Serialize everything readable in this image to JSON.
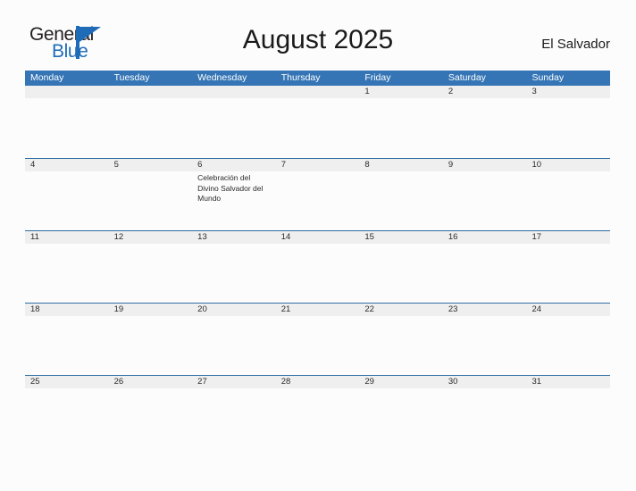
{
  "brand": {
    "word_one": "General",
    "word_two": "Blue",
    "accent_color": "#1e6bb8"
  },
  "header": {
    "title": "August 2025",
    "country": "El Salvador"
  },
  "colors": {
    "header_blue": "#3575b5",
    "rule_blue": "#2e6da4",
    "number_band": "#efeff0",
    "page_background": "#fcfcfd"
  },
  "calendar": {
    "day_headers": [
      "Monday",
      "Tuesday",
      "Wednesday",
      "Thursday",
      "Friday",
      "Saturday",
      "Sunday"
    ],
    "weeks": [
      {
        "days": [
          {
            "number": "",
            "event": ""
          },
          {
            "number": "",
            "event": ""
          },
          {
            "number": "",
            "event": ""
          },
          {
            "number": "",
            "event": ""
          },
          {
            "number": "1",
            "event": ""
          },
          {
            "number": "2",
            "event": ""
          },
          {
            "number": "3",
            "event": ""
          }
        ]
      },
      {
        "days": [
          {
            "number": "4",
            "event": ""
          },
          {
            "number": "5",
            "event": ""
          },
          {
            "number": "6",
            "event": "Celebración del Divino Salvador del Mundo"
          },
          {
            "number": "7",
            "event": ""
          },
          {
            "number": "8",
            "event": ""
          },
          {
            "number": "9",
            "event": ""
          },
          {
            "number": "10",
            "event": ""
          }
        ]
      },
      {
        "days": [
          {
            "number": "11",
            "event": ""
          },
          {
            "number": "12",
            "event": ""
          },
          {
            "number": "13",
            "event": ""
          },
          {
            "number": "14",
            "event": ""
          },
          {
            "number": "15",
            "event": ""
          },
          {
            "number": "16",
            "event": ""
          },
          {
            "number": "17",
            "event": ""
          }
        ]
      },
      {
        "days": [
          {
            "number": "18",
            "event": ""
          },
          {
            "number": "19",
            "event": ""
          },
          {
            "number": "20",
            "event": ""
          },
          {
            "number": "21",
            "event": ""
          },
          {
            "number": "22",
            "event": ""
          },
          {
            "number": "23",
            "event": ""
          },
          {
            "number": "24",
            "event": ""
          }
        ]
      },
      {
        "days": [
          {
            "number": "25",
            "event": ""
          },
          {
            "number": "26",
            "event": ""
          },
          {
            "number": "27",
            "event": ""
          },
          {
            "number": "28",
            "event": ""
          },
          {
            "number": "29",
            "event": ""
          },
          {
            "number": "30",
            "event": ""
          },
          {
            "number": "31",
            "event": ""
          }
        ]
      }
    ]
  }
}
